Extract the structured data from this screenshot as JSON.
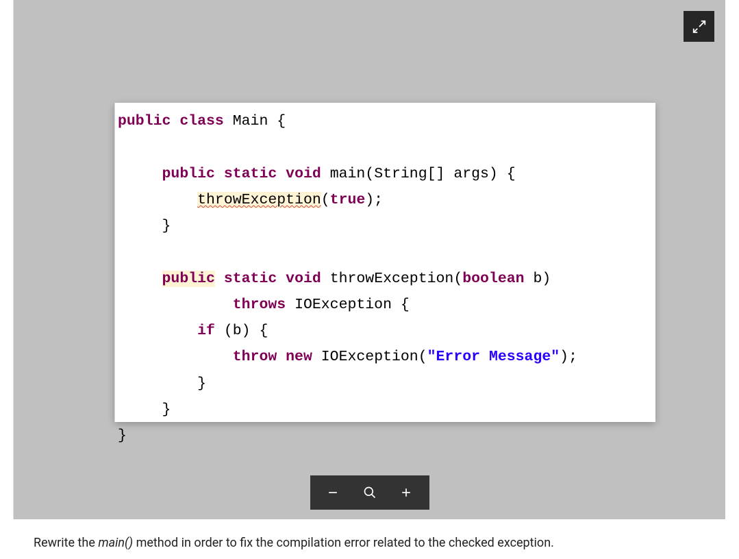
{
  "code": {
    "tokens": {
      "kw_public": "public",
      "kw_class": "class",
      "cls_Main": "Main",
      "brace_open": "{",
      "brace_close": "}",
      "kw_static": "static",
      "kw_void": "void",
      "m_main": "main",
      "p_main": "(String[] args)",
      "call_throwException": "throwException",
      "call_args": "(",
      "kw_true": "true",
      "call_end": ");",
      "m_throwException": "throwException",
      "p_throwException": "(",
      "kw_boolean": "boolean",
      "p_b": " b)",
      "kw_throws": "throws",
      "cls_IOException": "IOException",
      "kw_if": "if",
      "cond_b": "(b)",
      "kw_throw": "throw",
      "kw_new": "new",
      "str_msg": "\"Error Message\"",
      "paren_open": "(",
      "paren_close_semi": ");"
    }
  },
  "instruction": {
    "prefix": "Rewrite the ",
    "emphasis": "main()",
    "suffix": " method in order to fix the compilation error related to the checked exception."
  },
  "icons": {
    "fullscreen": "fullscreen-icon",
    "zoom_out": "minus-icon",
    "zoom_reset": "magnify-icon",
    "zoom_in": "plus-icon"
  }
}
